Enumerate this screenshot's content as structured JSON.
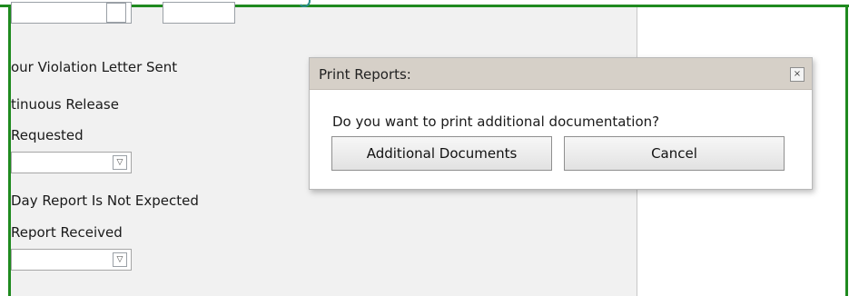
{
  "form": {
    "labels": {
      "violation_letter": "our Violation Letter Sent",
      "continuous_release": "tinuous Release",
      "requested": "Requested",
      "day_report": "Day Report Is Not Expected",
      "report_received": "Report Received"
    },
    "select_arrow": "chevron-down-icon"
  },
  "dialog": {
    "title": "Print Reports:",
    "close_symbol": "×",
    "message": "Do you want to print additional documentation?",
    "primary_button": "Additional Documents",
    "cancel_button": "Cancel"
  },
  "colors": {
    "highlight_frame": "#1f8a1f",
    "panel_bg": "#f1f1f1",
    "dialog_titlebar": "#d6d0c8"
  }
}
